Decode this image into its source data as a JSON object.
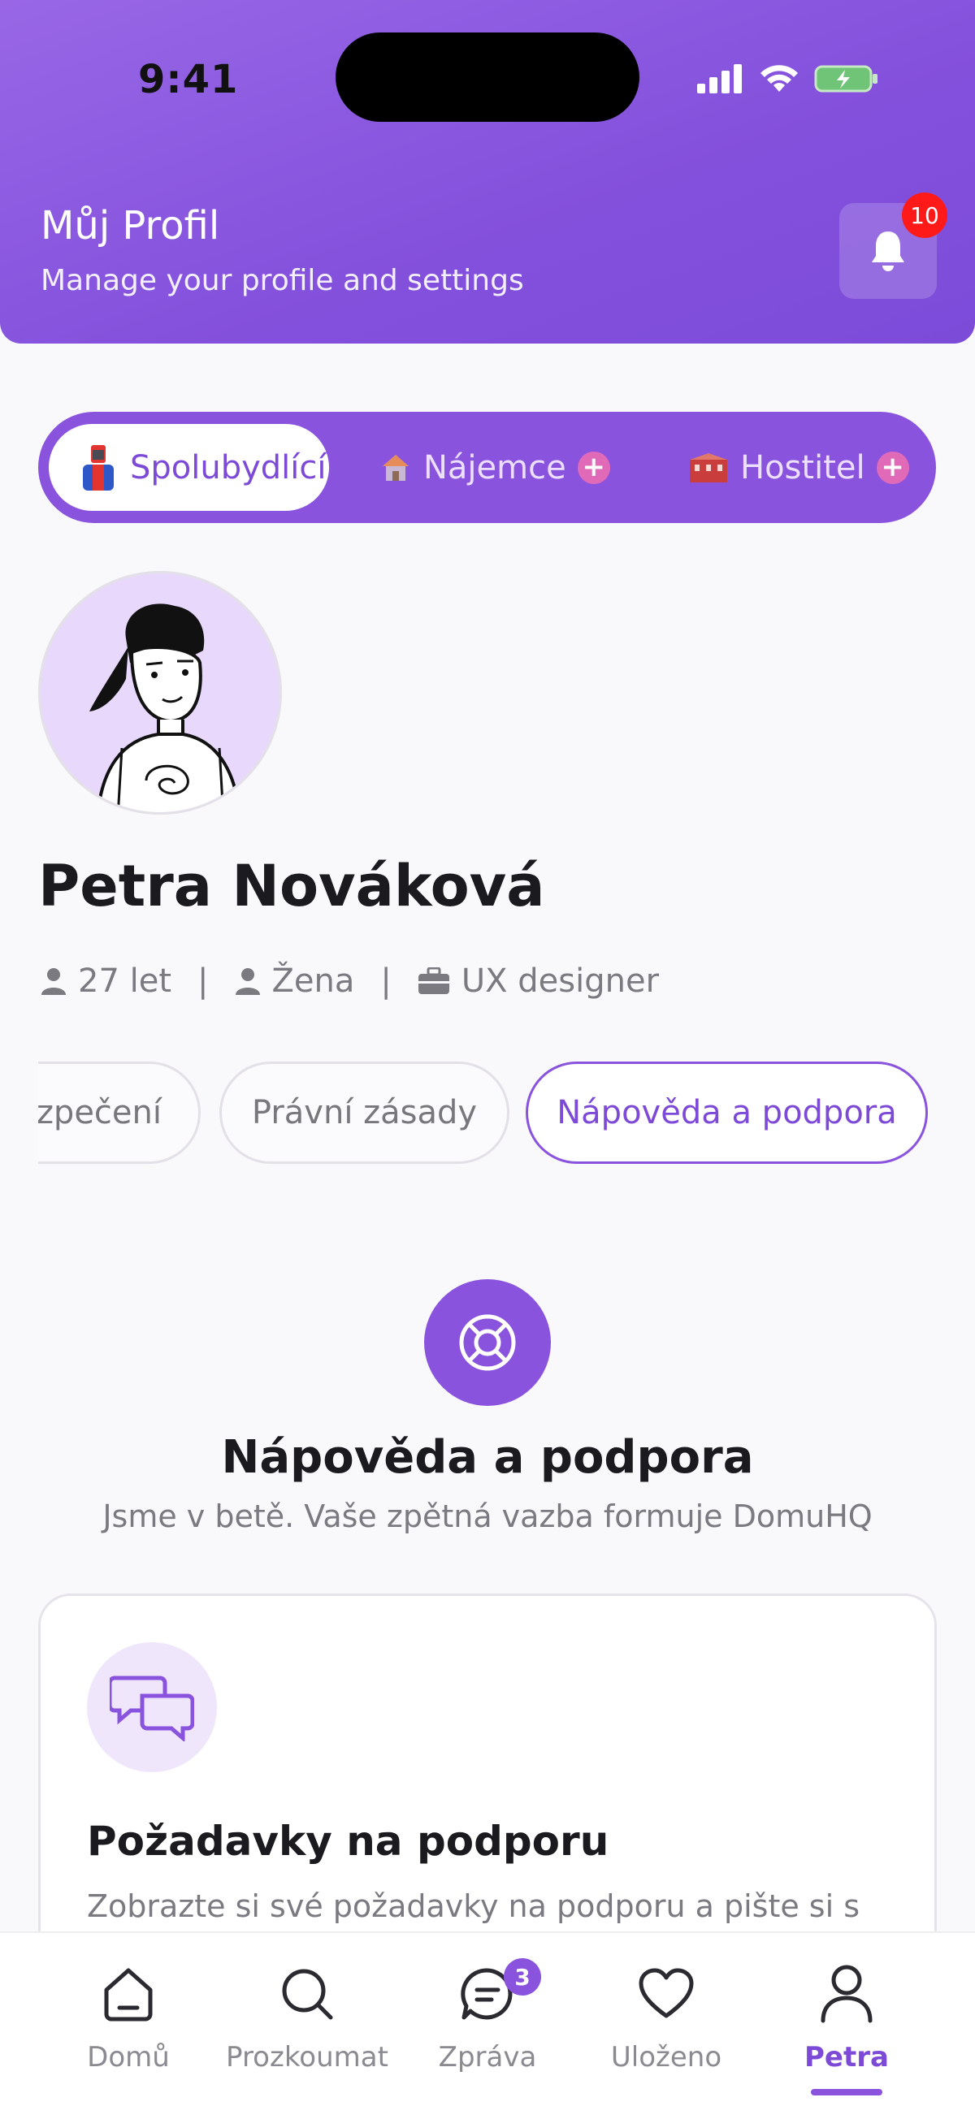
{
  "status_bar": {
    "time": "9:41"
  },
  "header": {
    "title": "Můj Profil",
    "subtitle": "Manage your profile and settings",
    "notification_count": "10"
  },
  "roles": [
    {
      "label": "Spolubydlící",
      "icon": "roommate-icon",
      "active": true
    },
    {
      "label": "Nájemce",
      "icon": "house-icon",
      "active": false
    },
    {
      "label": "Hostitel",
      "icon": "building-icon",
      "active": false
    }
  ],
  "profile": {
    "name": "Petra Nováková",
    "age": "27 let",
    "gender": "Žena",
    "occupation": "UX designer"
  },
  "section_chips": [
    {
      "label": "ezpečení",
      "active": false
    },
    {
      "label": "Právní zásady",
      "active": false
    },
    {
      "label": "Nápověda a podpora",
      "active": true
    }
  ],
  "help": {
    "title": "Nápověda a podpora",
    "subtitle": "Jsme v betě. Vaše zpětná vazba formuje DomuHQ"
  },
  "card": {
    "title": "Požadavky na podporu",
    "description": "Zobrazte si své požadavky na podporu a pište si s"
  },
  "bottom_nav": [
    {
      "label": "Domů",
      "icon": "home-icon"
    },
    {
      "label": "Prozkoumat",
      "icon": "search-icon"
    },
    {
      "label": "Zpráva",
      "icon": "message-icon",
      "badge": "3"
    },
    {
      "label": "Uloženo",
      "icon": "heart-icon"
    },
    {
      "label": "Petra",
      "icon": "user-icon",
      "active": true
    }
  ],
  "colors": {
    "accent": "#8a53de",
    "header_gradient_start": "#9867e6",
    "header_gradient_end": "#7c4cd9",
    "badge_red": "#ff1a1a"
  }
}
